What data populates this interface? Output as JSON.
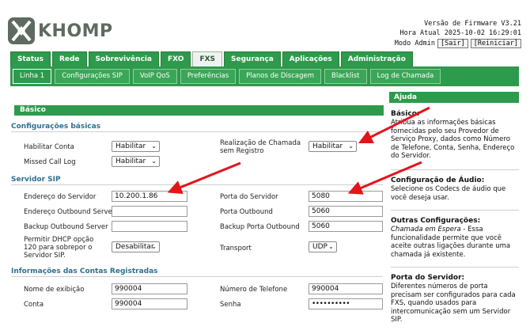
{
  "brand": {
    "name": "KHOMP"
  },
  "status": {
    "firmware": "Versão de Firmware V3.21",
    "time": "Hora Atual 2025-10-02 16:29:01",
    "mode": "Modo Admin",
    "logout": "[Sair]",
    "restart": "[Reiniciar]"
  },
  "main_nav": [
    "Status",
    "Rede",
    "Sobrevivência",
    "FXO",
    "FXS",
    "Segurança",
    "Aplicações",
    "Administração"
  ],
  "sub_nav": [
    "Linha 1",
    "Configurações SIP",
    "VoIP QoS",
    "Preferências",
    "Planos de Discagem",
    "Blacklist",
    "Log de Chamada"
  ],
  "panel": {
    "title": "Básico"
  },
  "basic": {
    "title": "Configurações básicas",
    "enable_label": "Habilitar Conta",
    "enable_value": "Habilitar",
    "missed_label": "Missed Call Log",
    "missed_value": "Habilitar",
    "unreg_label": "Realização de Chamada sem Registro",
    "unreg_value": "Habilitar"
  },
  "sip": {
    "title": "Servidor SIP",
    "server_label": "Endereço do Servidor",
    "server_value": "10.200.1.86",
    "outbound_label": "Endereço Outbound Server",
    "outbound_value": "",
    "backup_label": "Backup Outbound Server",
    "backup_value": "",
    "dhcp_label": "Permitir DHCP opção 120 para sobrepor o Servidor SIP.",
    "dhcp_value": "Desabilitar",
    "port_label": "Porta do Servidor",
    "port_value": "5080",
    "outport_label": "Porta Outbound",
    "outport_value": "5060",
    "backport_label": "Backup Porta Outbound",
    "backport_value": "5060",
    "transport_label": "Transport",
    "transport_value": "UDP"
  },
  "account": {
    "title": "Informações das Contas Registradas",
    "display_label": "Nome de exibição",
    "display_value": "990004",
    "account_label": "Conta",
    "account_value": "990004",
    "phone_label": "Número de Telefone",
    "phone_value": "990004",
    "password_label": "Senha",
    "password_value": "••••••••••"
  },
  "help": {
    "title": "Ajuda",
    "s1_title": "Básico:",
    "s1_text": "Atribua as informações básicas fornecidas pelo seu Provedor de Serviço Proxy, dados como Número de Telefone, Conta, Senha, Endereço do Servidor.",
    "s2_title": "Configuração de Áudio:",
    "s2_text": "Selecione os Codecs de áudio que você deseja usar.",
    "s3_title": "Outras Configurações:",
    "s3_em": "Chamada em Espera",
    "s3_text": " - Essa funcionalidade permite que você aceite outras ligações durante uma chamada já existente.",
    "s4_title": "Porta do Servidor:",
    "s4_text": "Diferentes números de porta precisam ser configurados para cada FXS, quando usados para intercomunicação sem um Servidor SIP."
  },
  "colors": {
    "accent_green": "#2e9a4c",
    "section_blue": "#2e6f8f",
    "arrow_red": "#e3141b"
  }
}
